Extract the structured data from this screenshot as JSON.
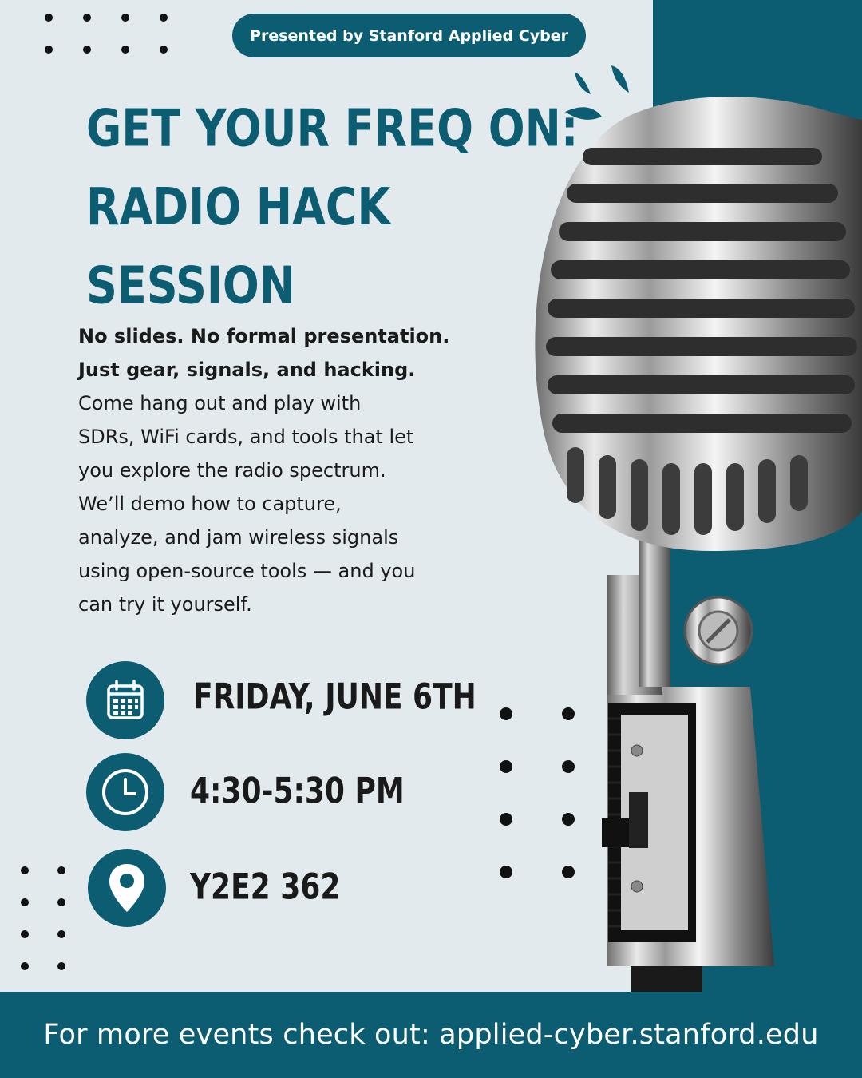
{
  "header": {
    "presenter": "Presented by Stanford Applied Cyber"
  },
  "title": {
    "line1": "GET YOUR FREQ ON:",
    "line2": "RADIO HACK",
    "line3": "SESSION"
  },
  "description": {
    "bold_lines": [
      "No slides. No formal presentation.",
      "Just gear, signals, and hacking."
    ],
    "lines": [
      "Come hang out and play with",
      "SDRs, WiFi cards, and tools that let",
      "you explore the radio spectrum.",
      "We’ll demo how to capture,",
      "analyze, and jam wireless signals",
      "using open-source tools — and you",
      "can try it yourself."
    ]
  },
  "event": {
    "date": "FRIDAY, JUNE 6TH",
    "time": "4:30-5:30 PM",
    "location": "Y2E2 362"
  },
  "footer": {
    "text": "For more events check out:  applied-cyber.stanford.edu"
  },
  "colors": {
    "teal": "#0d5d72",
    "background": "#e2eaee",
    "text": "#1a1a1a"
  },
  "icons": [
    "calendar-icon",
    "clock-icon",
    "location-pin-icon",
    "microphone-image"
  ]
}
